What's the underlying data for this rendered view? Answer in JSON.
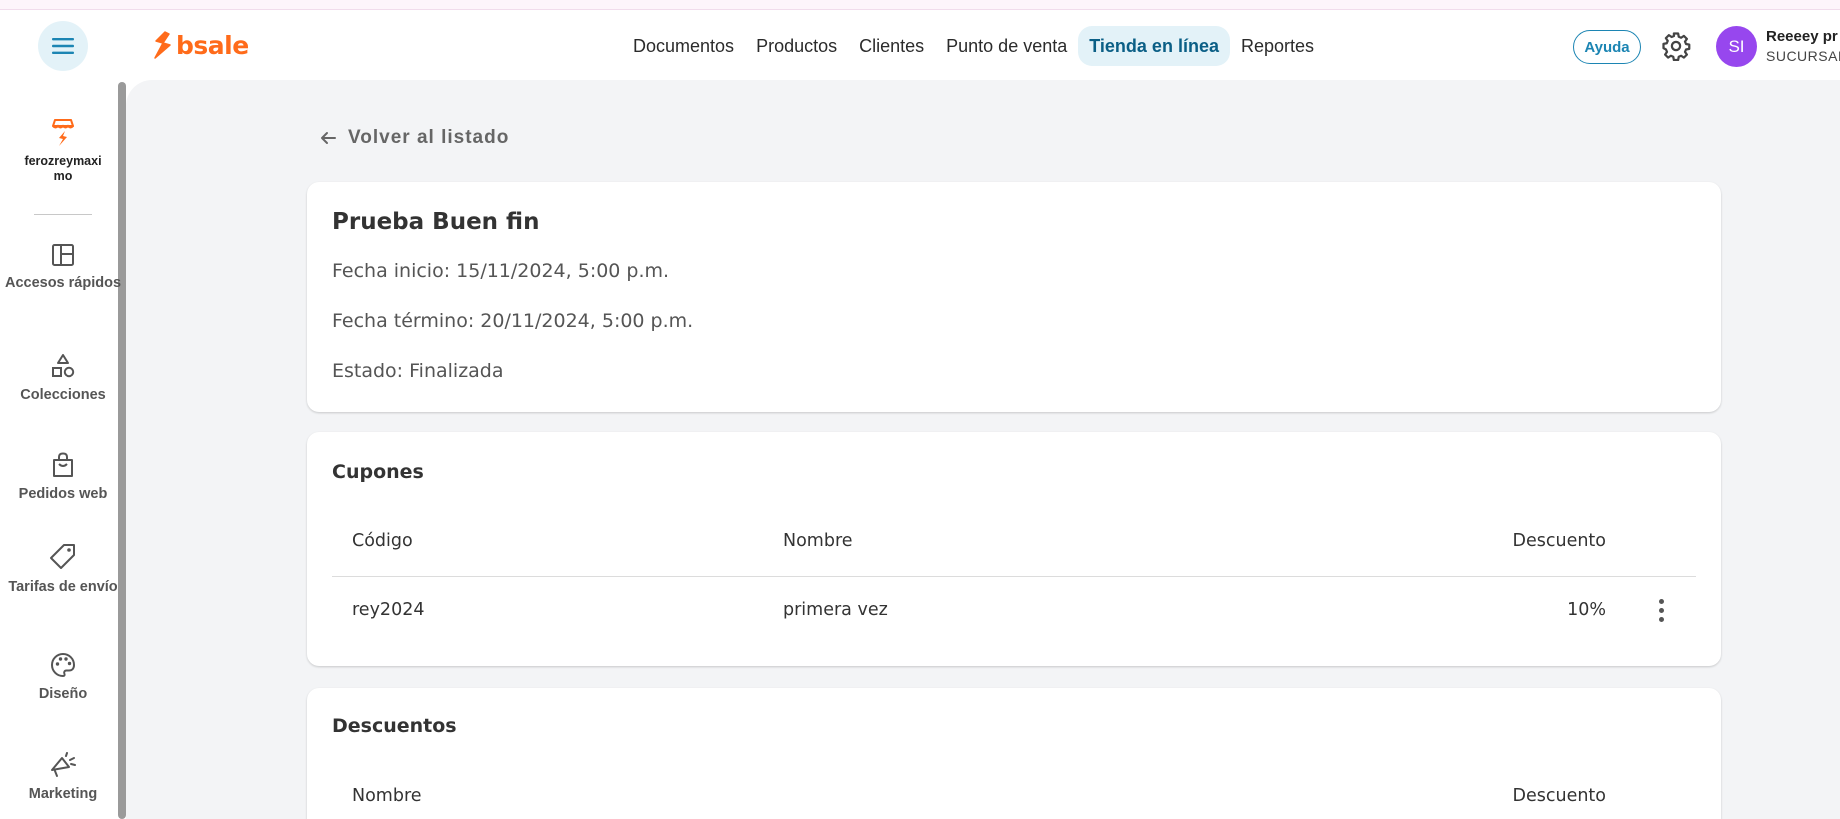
{
  "header": {
    "brand": "bsale",
    "nav": [
      {
        "label": "Documentos"
      },
      {
        "label": "Productos"
      },
      {
        "label": "Clientes"
      },
      {
        "label": "Punto de venta"
      },
      {
        "label": "Tienda en línea",
        "active": true
      },
      {
        "label": "Reportes"
      }
    ],
    "help_label": "Ayuda",
    "user": {
      "initials": "SI",
      "name": "Reeeey pr",
      "branch": "SUCURSAL"
    },
    "accent_color": "#ff6b1a",
    "avatar_color": "#9747ee"
  },
  "sidebar": {
    "store": {
      "label": "ferozreymaximo",
      "icon": "store-icon"
    },
    "items": [
      {
        "label": "Accesos rápidos",
        "icon": "layout-icon"
      },
      {
        "label": "Colecciones",
        "icon": "shapes-icon"
      },
      {
        "label": "Pedidos web",
        "icon": "shopping-bag-icon"
      },
      {
        "label": "Tarifas de envío",
        "icon": "tag-icon"
      },
      {
        "label": "Diseño",
        "icon": "palette-icon"
      },
      {
        "label": "Marketing",
        "icon": "megaphone-icon"
      }
    ]
  },
  "main": {
    "back_label": "Volver al listado",
    "promo": {
      "title": "Prueba Buen fin",
      "start": "Fecha inicio: 15/11/2024, 5:00 p.m.",
      "end": "Fecha término: 20/11/2024, 5:00 p.m.",
      "status": "Estado: Finalizada"
    },
    "coupons": {
      "title": "Cupones",
      "columns": [
        "Código",
        "Nombre",
        "Descuento"
      ],
      "rows": [
        {
          "code": "rey2024",
          "name": "primera vez",
          "discount": "10%"
        }
      ]
    },
    "discounts": {
      "title": "Descuentos",
      "columns": [
        "Nombre",
        "Descuento"
      ]
    }
  }
}
